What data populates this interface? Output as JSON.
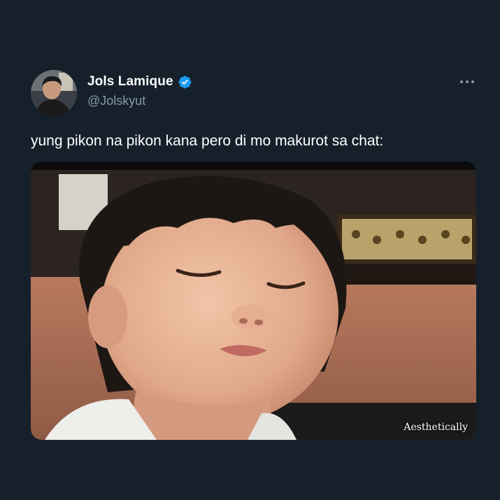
{
  "tweet": {
    "display_name": "Jols Lamique",
    "handle": "@Jolskyut",
    "text": "yung pikon na pikon kana pero di mo makurot sa chat:",
    "verified_icon": "verified-badge-icon",
    "more_icon": "more-options-icon"
  },
  "media": {
    "watermark": "Aesthetically"
  },
  "colors": {
    "background": "#15202b",
    "verified": "#1d9bf0",
    "handle": "#8899a6"
  }
}
